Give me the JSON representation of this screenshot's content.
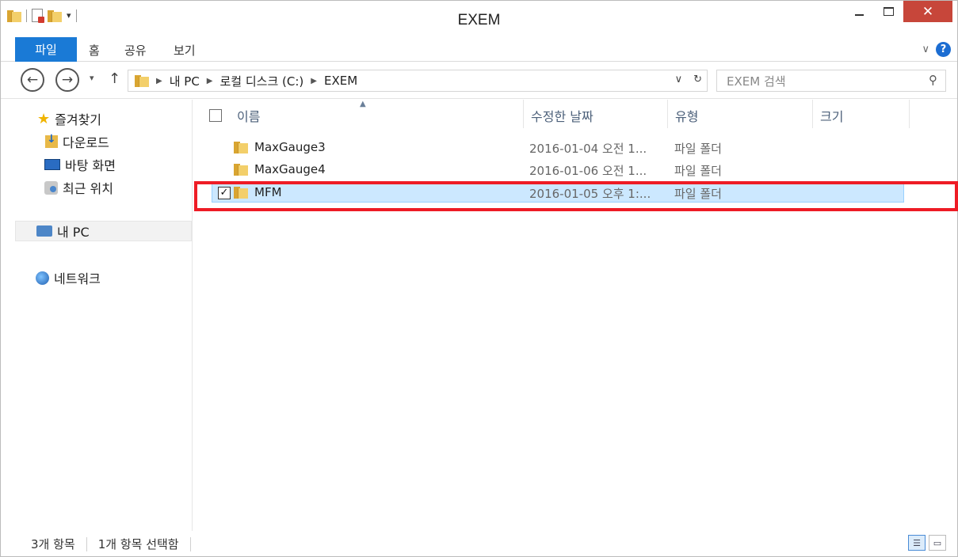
{
  "window": {
    "title": "EXEM"
  },
  "ribbon": {
    "tabs": [
      {
        "label": "파일",
        "active": true
      },
      {
        "label": "홈"
      },
      {
        "label": "공유"
      },
      {
        "label": "보기"
      }
    ],
    "accent": "#1a7ad6"
  },
  "address": {
    "path": [
      "내 PC",
      "로컬 디스크 (C:)",
      "EXEM"
    ],
    "search_placeholder": "EXEM 검색"
  },
  "nav": {
    "favorites": {
      "label": "즐겨찾기",
      "icon": "star-icon"
    },
    "downloads": {
      "label": "다운로드",
      "icon": "downloads-icon"
    },
    "desktop": {
      "label": "바탕 화면",
      "icon": "desktop-icon"
    },
    "recent": {
      "label": "최근 위치",
      "icon": "recent-places-icon"
    },
    "this_pc": {
      "label": "내 PC",
      "icon": "computer-icon"
    },
    "network": {
      "label": "네트워크",
      "icon": "network-icon"
    }
  },
  "columns": {
    "name": "이름",
    "date": "수정한 날짜",
    "type": "유형",
    "size": "크기"
  },
  "files": [
    {
      "name": "MaxGauge3",
      "date": "2016-01-04 오전 1...",
      "type": "파일 폴더",
      "selected": false
    },
    {
      "name": "MaxGauge4",
      "date": "2016-01-06 오전 1...",
      "type": "파일 폴더",
      "selected": false
    },
    {
      "name": "MFM",
      "date": "2016-01-05 오후 1:...",
      "type": "파일 폴더",
      "selected": true
    }
  ],
  "status": {
    "count": "3개 항목",
    "selected": "1개 항목 선택함"
  },
  "colors": {
    "selection": "#cce8ff",
    "highlight_box": "#ee1c25",
    "close_button": "#c7463a"
  }
}
